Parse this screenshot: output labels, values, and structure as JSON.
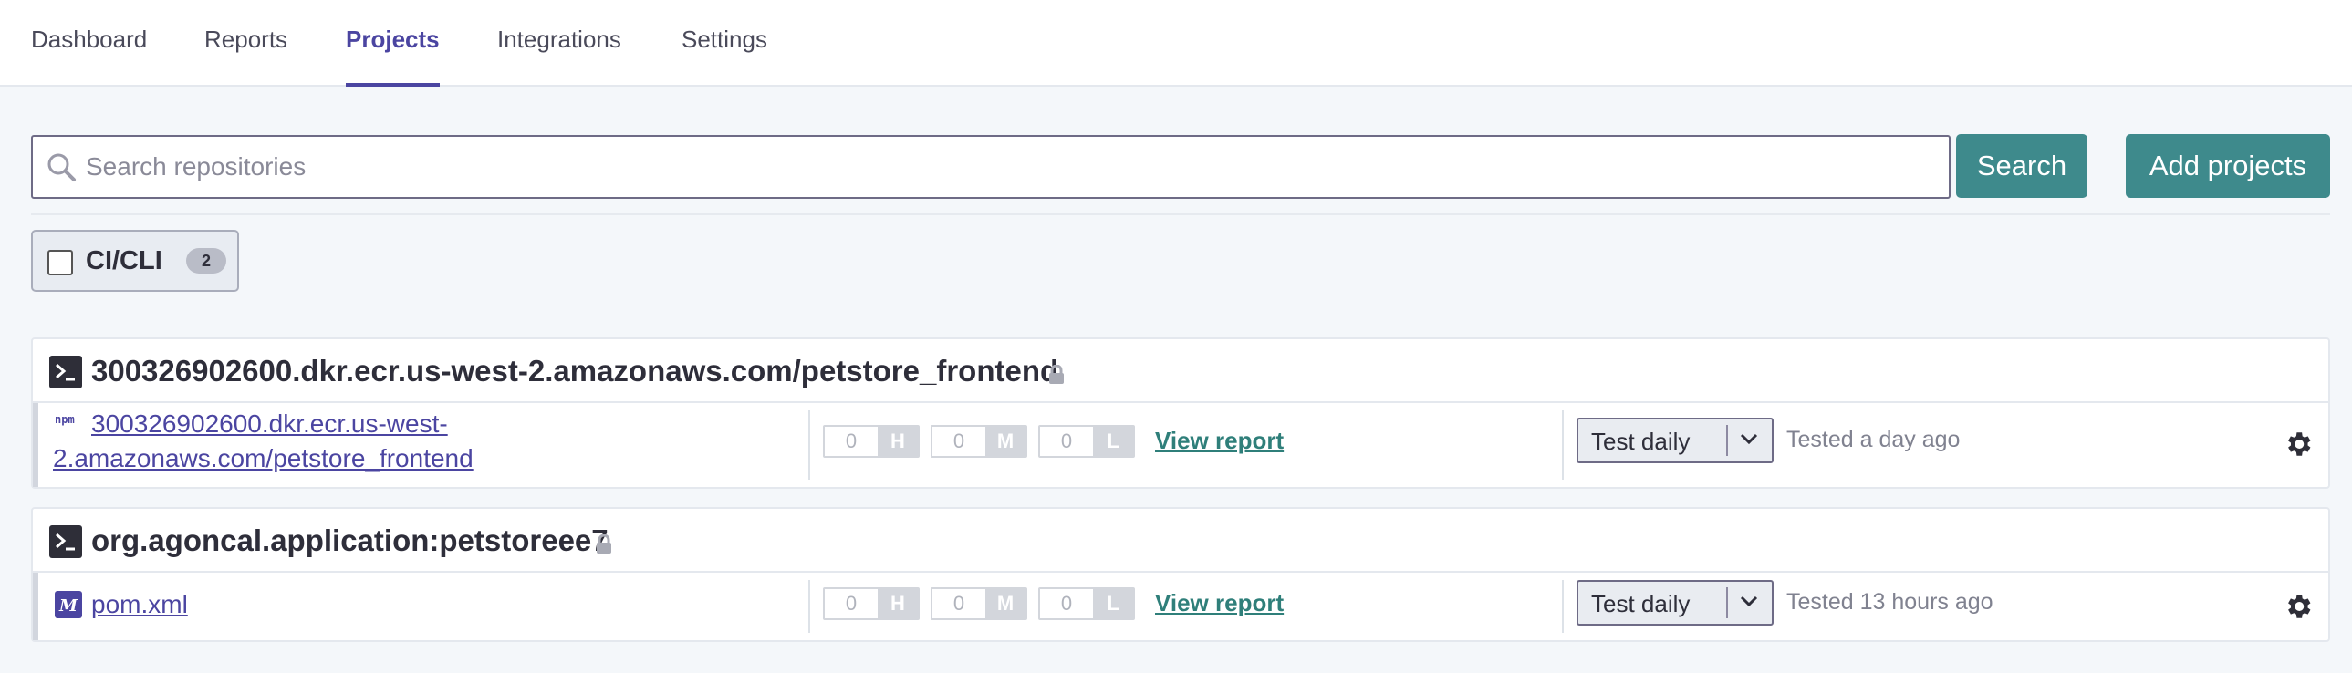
{
  "nav": {
    "tabs": [
      {
        "label": "Dashboard"
      },
      {
        "label": "Reports"
      },
      {
        "label": "Projects",
        "active": true
      },
      {
        "label": "Integrations"
      },
      {
        "label": "Settings"
      }
    ]
  },
  "search": {
    "placeholder": "Search repositories",
    "value": "",
    "button_label": "Search"
  },
  "add_projects_label": "Add projects",
  "filter": {
    "label": "CI/CLI",
    "count": "2",
    "checked": false
  },
  "projects": [
    {
      "title": "300326902600.dkr.ecr.us-west-2.amazonaws.com/petstore_frontend",
      "locked": true,
      "target": {
        "icon": "npm-icon",
        "name_line1": "300326902600.dkr.ecr.us-west-",
        "name_line2": "2.amazonaws.com/petstore_frontend",
        "high": "0",
        "high_key": "H",
        "medium": "0",
        "medium_key": "M",
        "low": "0",
        "low_key": "L",
        "view_report": "View report",
        "frequency": "Test daily",
        "tested": "Tested a day ago"
      }
    },
    {
      "title": "org.agoncal.application:petstoreee7",
      "locked": true,
      "target": {
        "icon": "maven-icon",
        "name": "pom.xml",
        "high": "0",
        "high_key": "H",
        "medium": "0",
        "medium_key": "M",
        "low": "0",
        "low_key": "L",
        "view_report": "View report",
        "frequency": "Test daily",
        "tested": "Tested 13 hours ago"
      }
    }
  ],
  "colors": {
    "accent_purple": "#4b45a1",
    "teal_button": "#3e8a8c",
    "link_teal": "#2f7f7a"
  }
}
